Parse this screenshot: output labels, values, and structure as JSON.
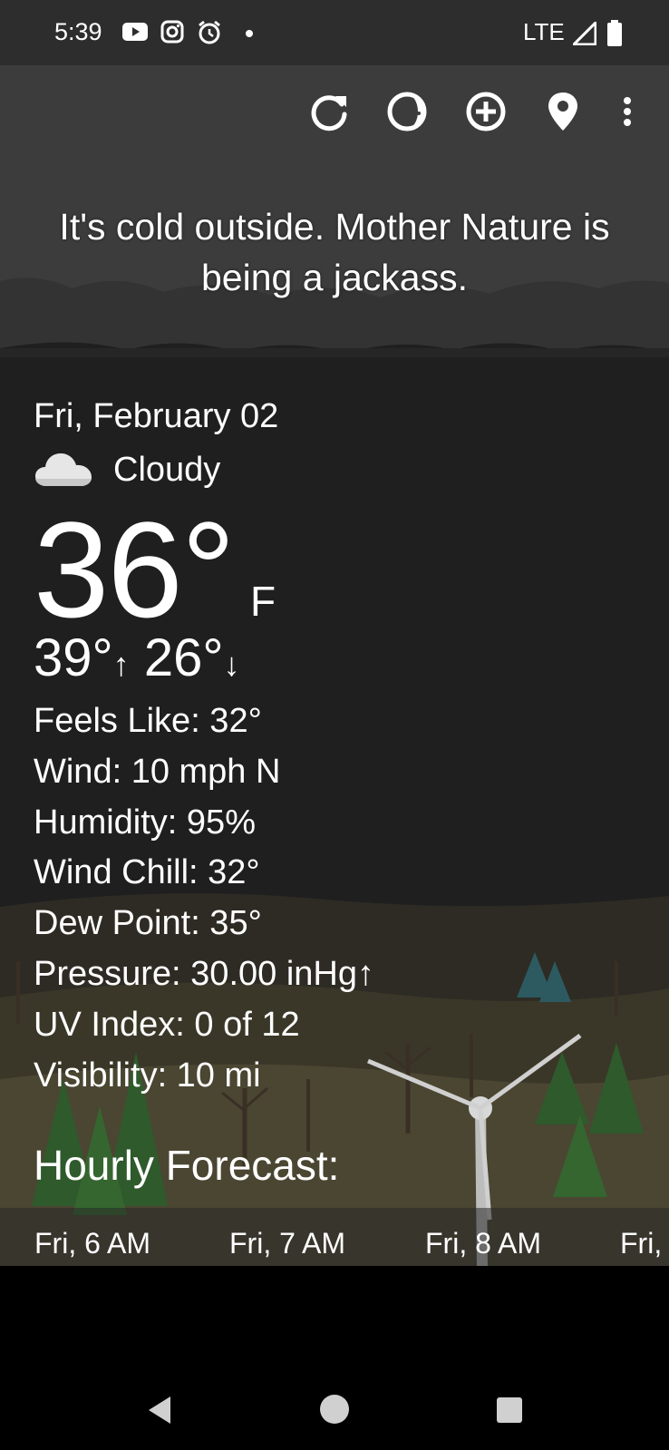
{
  "status_bar": {
    "time": "5:39",
    "notification_icons": [
      "youtube-icon",
      "instagram-icon",
      "alarm-icon",
      "dot-icon"
    ],
    "network": "LTE",
    "signal_icon": "signal-icon",
    "battery_icon": "battery-icon"
  },
  "toolbar": {
    "actions": [
      "refresh-icon",
      "theme-icon",
      "add-location-icon",
      "location-pin-icon",
      "more-options-icon"
    ]
  },
  "tagline": "It's cold outside. Mother Nature is being a jackass.",
  "current": {
    "date": "Fri, February 02",
    "condition_icon": "cloud-icon",
    "condition": "Cloudy",
    "temperature": "36°",
    "unit": "F",
    "high": "39°",
    "high_arrow": "↑",
    "low": "26°",
    "low_arrow": "↓"
  },
  "details": [
    {
      "text": "Feels Like:  32°"
    },
    {
      "text": "Wind:  10 mph N"
    },
    {
      "text": "Humidity:  95%"
    },
    {
      "text": "Wind Chill:  32°"
    },
    {
      "text": "Dew Point:  35°"
    },
    {
      "text": "Pressure:  30.00 inHg↑"
    },
    {
      "text": "UV Index:  0 of 12"
    },
    {
      "text": "Visibility:  10 mi"
    }
  ],
  "hourly": {
    "title": "Hourly Forecast:",
    "items": [
      "Fri, 6 AM",
      "Fri, 7 AM",
      "Fri, 8 AM",
      "Fri,"
    ]
  },
  "nav": {
    "back_icon": "back-icon",
    "home_icon": "home-icon",
    "recents_icon": "recents-icon"
  }
}
